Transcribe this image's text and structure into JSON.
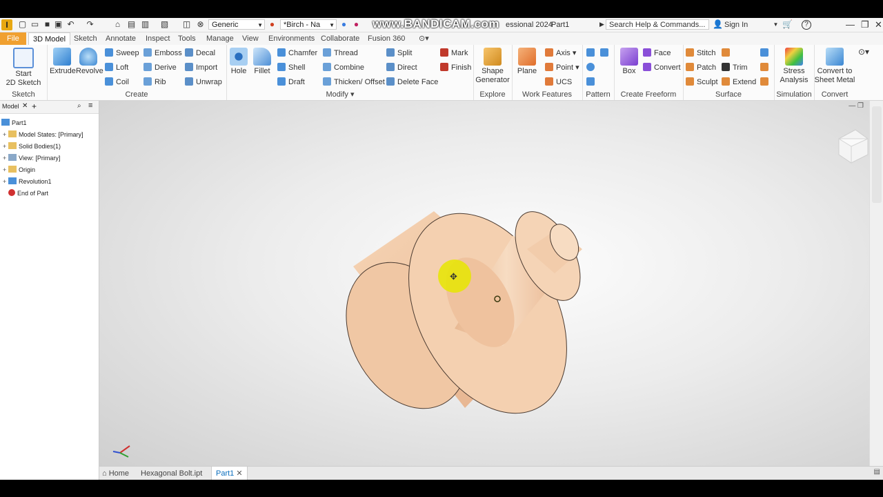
{
  "app": {
    "logo_letter": "I",
    "title_fragment": "essional 2024",
    "document_name": "Part1",
    "search_placeholder": "Search Help & Commands...",
    "sign_in": "Sign In",
    "watermark": "www.BANDICAM.com"
  },
  "quick_access": {
    "appearance_select": "Generic",
    "material_select": "*Birch - Na"
  },
  "ribbon_tabs": [
    {
      "label": "File"
    },
    {
      "label": "3D Model"
    },
    {
      "label": "Sketch"
    },
    {
      "label": "Annotate"
    },
    {
      "label": "Inspect"
    },
    {
      "label": "Tools"
    },
    {
      "label": "Manage"
    },
    {
      "label": "View"
    },
    {
      "label": "Environments"
    },
    {
      "label": "Collaborate"
    },
    {
      "label": "Fusion 360"
    }
  ],
  "ribbon": {
    "sketch": {
      "label": "Sketch",
      "start_line1": "Start",
      "start_line2": "2D Sketch"
    },
    "create": {
      "label": "Create",
      "extrude": "Extrude",
      "revolve": "Revolve",
      "sweep": "Sweep",
      "emboss": "Emboss",
      "decal": "Decal",
      "loft": "Loft",
      "derive": "Derive",
      "import": "Import",
      "coil": "Coil",
      "rib": "Rib",
      "unwrap": "Unwrap"
    },
    "modify": {
      "label": "Modify",
      "hole": "Hole",
      "fillet": "Fillet",
      "chamfer": "Chamfer",
      "thread": "Thread",
      "split": "Split",
      "shell": "Shell",
      "combine": "Combine",
      "direct": "Direct",
      "draft": "Draft",
      "thicken": "Thicken/ Offset",
      "delete_face": "Delete Face"
    },
    "explore": {
      "label": "Explore",
      "mark": "Mark",
      "finish": "Finish",
      "shape_line1": "Shape",
      "shape_line2": "Generator"
    },
    "work_features": {
      "label": "Work Features",
      "plane": "Plane",
      "axis": "Axis",
      "point": "Point",
      "ucs": "UCS"
    },
    "pattern": {
      "label": "Pattern"
    },
    "create_freeform": {
      "label": "Create Freeform",
      "box": "Box",
      "face": "Face",
      "convert": "Convert"
    },
    "surface": {
      "label": "Surface",
      "stitch": "Stitch",
      "patch": "Patch",
      "trim": "Trim",
      "sculpt": "Sculpt",
      "extend": "Extend"
    },
    "simulation": {
      "label": "Simulation",
      "stress_line1": "Stress",
      "stress_line2": "Analysis"
    },
    "convert": {
      "label": "Convert",
      "sm_line1": "Convert to",
      "sm_line2": "Sheet Metal"
    }
  },
  "browser": {
    "title": "Model",
    "items": [
      {
        "label": "Part1"
      },
      {
        "label": "Model States: [Primary]"
      },
      {
        "label": "Solid Bodies(1)"
      },
      {
        "label": "View: [Primary]"
      },
      {
        "label": "Origin"
      },
      {
        "label": "Revolution1"
      },
      {
        "label": "End of Part"
      }
    ]
  },
  "document_tabs": [
    {
      "label": "Home"
    },
    {
      "label": "Hexagonal Bolt.ipt"
    },
    {
      "label": "Part1"
    }
  ],
  "colors": {
    "accent_file_tab": "#f0a030",
    "wood": "#f2c9a4",
    "cursor_highlight": "#e6e600"
  }
}
